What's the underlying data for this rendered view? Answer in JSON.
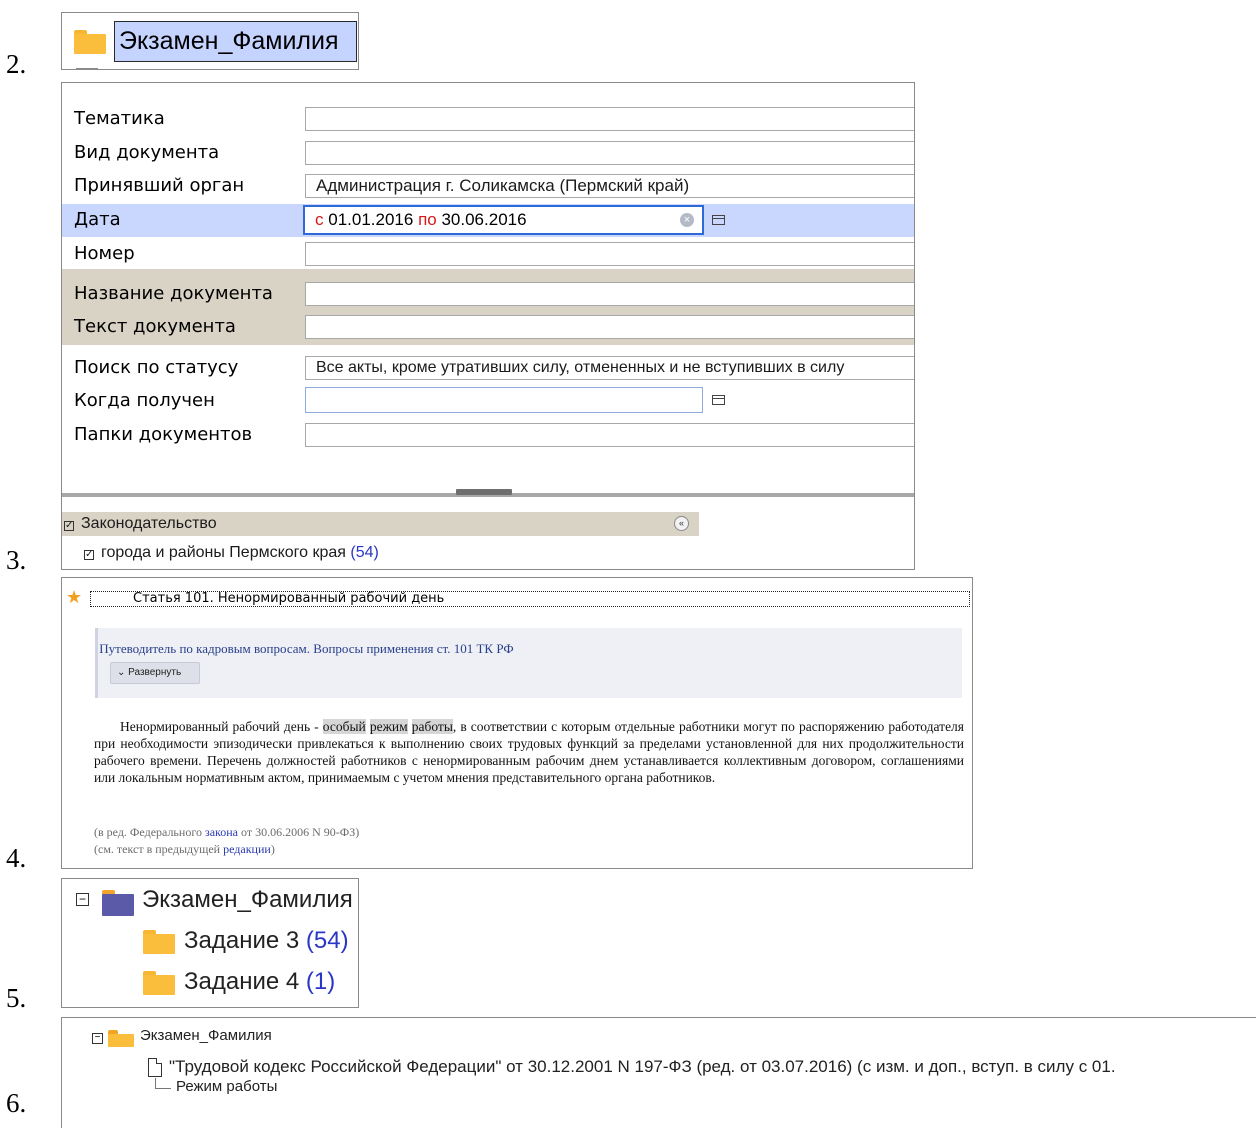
{
  "steps": [
    "2.",
    "3.",
    "4.",
    "5.",
    "6."
  ],
  "panel2": {
    "folder_name": "Экзамен_Фамилия"
  },
  "panel3": {
    "fields": [
      {
        "label": "Тематика",
        "value": ""
      },
      {
        "label": "Вид документа",
        "value": ""
      },
      {
        "label": "Принявший орган",
        "value": "Администрация г. Соликамска (Пермский край)"
      },
      {
        "label": "Дата",
        "value": ""
      },
      {
        "label": "Номер",
        "value": ""
      },
      {
        "label": "Название документа",
        "value": ""
      },
      {
        "label": "Текст документа",
        "value": ""
      },
      {
        "label": "Поиск по статусу",
        "value": "Все акты, кроме утративших силу, отмененных и не вступивших в силу"
      },
      {
        "label": "Когда получен",
        "value": ""
      },
      {
        "label": "Папки документов",
        "value": ""
      }
    ],
    "date": {
      "from_word": "с",
      "from": "01.01.2016",
      "to_word": "по",
      "to": "30.06.2016"
    },
    "legislation": {
      "label": "Законодательство",
      "sub_label": "города и районы Пермского края",
      "count": "(54)"
    }
  },
  "panel4": {
    "title": "Статья 101. Ненормированный рабочий день",
    "guide_link": "Путеводитель по кадровым вопросам. Вопросы применения ст. 101 ТК РФ",
    "expand_label": "Развернуть",
    "text_before": "Ненормированный рабочий день - ",
    "hl1": "особый",
    "hl2": "режим",
    "hl3": "работы",
    "text_after": ", в соответствии с которым отдельные работники могут по распоряжению работодателя при необходимости эпизодически привлекаться к выполнению своих трудовых функций за пределами установленной для них продолжительности рабочего времени. Перечень должностей работников с ненормированным рабочим днем устанавливается коллективным договором, соглашениями или локальным нормативным актом, принимаемым с учетом мнения представительного органа работников.",
    "note1_a": "(в ред. Федерального ",
    "note1_link": "закона",
    "note1_b": " от 30.06.2006 N 90-ФЗ)",
    "note2_a": "(см. текст в предыдущей ",
    "note2_link": "редакции",
    "note2_b": ")"
  },
  "panel5": {
    "root": "Экзамен_Фамилия",
    "items": [
      {
        "label": "Задание 3",
        "count": "(54)"
      },
      {
        "label": "Задание 4",
        "count": "(1)"
      }
    ]
  },
  "panel6": {
    "root": "Экзамен_Фамилия",
    "doc": "\"Трудовой кодекс Российской Федерации\" от 30.12.2001 N 197-ФЗ (ред. от 03.07.2016) (с изм. и доп., вступ. в силу с 01.",
    "sub": "Режим работы"
  },
  "icons": {
    "folder": "folder-icon",
    "open_folder": "folder-open-icon",
    "calendar": "calendar-icon",
    "clear": "clear-icon",
    "star": "star-icon",
    "document": "document-icon",
    "collapse": "collapse-icon"
  }
}
